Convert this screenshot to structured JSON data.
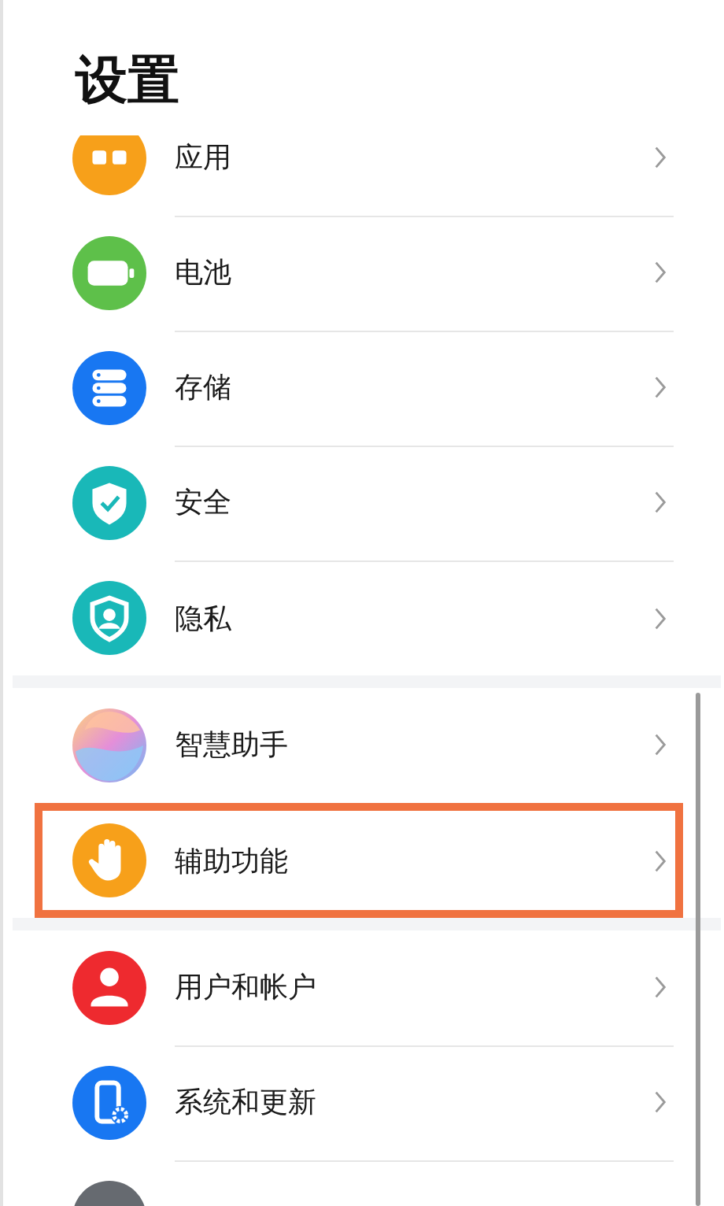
{
  "title": "设置",
  "groups": [
    {
      "items": [
        {
          "label": "应用",
          "kind": "apps",
          "highlighted": false
        },
        {
          "label": "电池",
          "kind": "battery",
          "highlighted": false
        },
        {
          "label": "存储",
          "kind": "storage",
          "highlighted": false
        },
        {
          "label": "安全",
          "kind": "security",
          "highlighted": false
        },
        {
          "label": "隐私",
          "kind": "privacy",
          "highlighted": false
        }
      ]
    },
    {
      "items": [
        {
          "label": "智慧助手",
          "kind": "assistant",
          "highlighted": false
        },
        {
          "label": "辅助功能",
          "kind": "hand",
          "highlighted": true
        }
      ]
    },
    {
      "items": [
        {
          "label": "用户和帐户",
          "kind": "user",
          "highlighted": false
        },
        {
          "label": "系统和更新",
          "kind": "system",
          "highlighted": false
        },
        {
          "kind": "partial"
        }
      ]
    }
  ]
}
